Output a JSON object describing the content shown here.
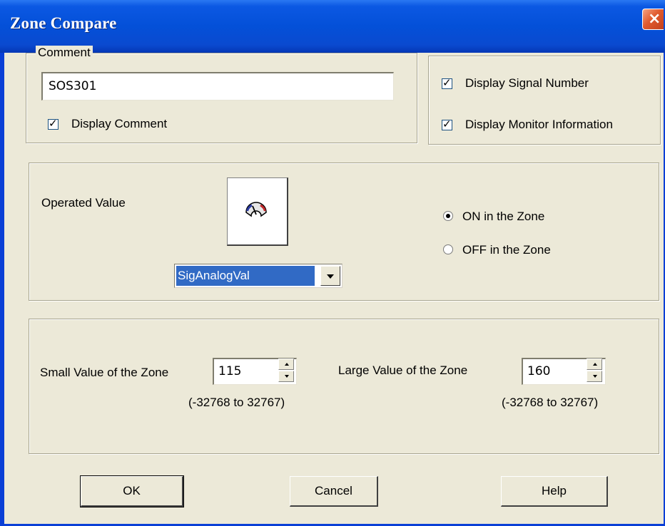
{
  "window": {
    "title": "Zone Compare",
    "close_glyph": "×"
  },
  "comment_group": {
    "legend": "Comment",
    "comment_value": "SOS301",
    "display_comment": {
      "label": "Display Comment",
      "checked": true
    }
  },
  "display_group": {
    "display_signal_number": {
      "label": "Display Signal Number",
      "checked": true
    },
    "display_monitor_information": {
      "label": "Display Monitor Information",
      "checked": true
    }
  },
  "operated_group": {
    "label": "Operated Value",
    "icon": "analog-meter-icon",
    "selected_value": "SigAnalogVal",
    "mode_options": [
      {
        "label": "ON in the Zone",
        "selected": true
      },
      {
        "label": "OFF in the Zone",
        "selected": false
      }
    ]
  },
  "zone_group": {
    "small": {
      "label": "Small Value of the Zone",
      "value": "115",
      "range": "(-32768 to 32767)"
    },
    "large": {
      "label": "Large Value of the Zone",
      "value": "160",
      "range": "(-32768 to 32767)"
    }
  },
  "buttons": {
    "ok": "OK",
    "cancel": "Cancel",
    "help": "Help"
  },
  "colors": {
    "titlebar": "#0450d8",
    "dialog_bg": "#ece9d8",
    "selection": "#316ac5",
    "close_button": "#e05a2e"
  }
}
